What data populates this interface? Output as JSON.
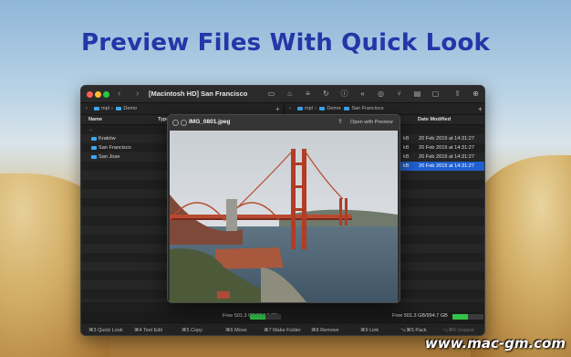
{
  "headline": "Preview Files With Quick Look",
  "watermark": "www.mac-gm.com",
  "window": {
    "title": "[Macintosh HD] San Francisco",
    "toolbar_icons": [
      "display-icon",
      "home-icon",
      "list-icon",
      "refresh-icon",
      "info-icon",
      "globe-icon",
      "rewind-icon",
      "git-icon",
      "panel-icon",
      "square-icon",
      "share-icon",
      "download-icon"
    ]
  },
  "left_pane": {
    "path": [
      "mpl",
      "Demo"
    ],
    "columns": {
      "name": "Name",
      "type": "Type"
    },
    "rows": [
      {
        "name": "..",
        "size": "",
        "date": ""
      },
      {
        "name": "Kraków",
        "size": "",
        "date": ""
      },
      {
        "name": "San Francisco",
        "size": "",
        "date": ""
      },
      {
        "name": "San Jose",
        "size": "",
        "date": ""
      }
    ],
    "free_space": "Free 501.3 GB/994.7 GB",
    "free_fraction": 0.5
  },
  "right_pane": {
    "path": [
      "mpl",
      "Demo",
      "San Francisco"
    ],
    "columns": {
      "date": "Date Modified"
    },
    "rows": [
      {
        "size": "",
        "date": ""
      },
      {
        "size": "kB",
        "date": "20 Feb 2019 at 14:31:27"
      },
      {
        "size": "kB",
        "date": "20 Feb 2019 at 14:31:27"
      },
      {
        "size": "kB",
        "date": "20 Feb 2019 at 14:31:27"
      },
      {
        "size": "kB",
        "date": "20 Feb 2019 at 14:31:27"
      }
    ],
    "free_space": "Free 501.3 GB/994.7 GB",
    "free_fraction": 0.5
  },
  "function_bar": [
    {
      "label": "⌘3 Quick Look",
      "enabled": true
    },
    {
      "label": "⌘4 Text Edit",
      "enabled": true
    },
    {
      "label": "⌘5 Copy",
      "enabled": true
    },
    {
      "label": "⌘6 Move",
      "enabled": true
    },
    {
      "label": "⌘7 Make Folder",
      "enabled": true
    },
    {
      "label": "⌘8 Remove",
      "enabled": true
    },
    {
      "label": "⌘9 Link",
      "enabled": true
    },
    {
      "label": "⌥⌘5 Pack",
      "enabled": true
    },
    {
      "label": "⌥⌘6 Unpack",
      "enabled": false
    }
  ],
  "quicklook": {
    "filename": "IMG_0801.jpeg",
    "open_with": "Open with Preview"
  },
  "colors": {
    "accent": "#1f5fd0",
    "folder": "#3fa7f0",
    "free_bar": "#33c24a"
  }
}
